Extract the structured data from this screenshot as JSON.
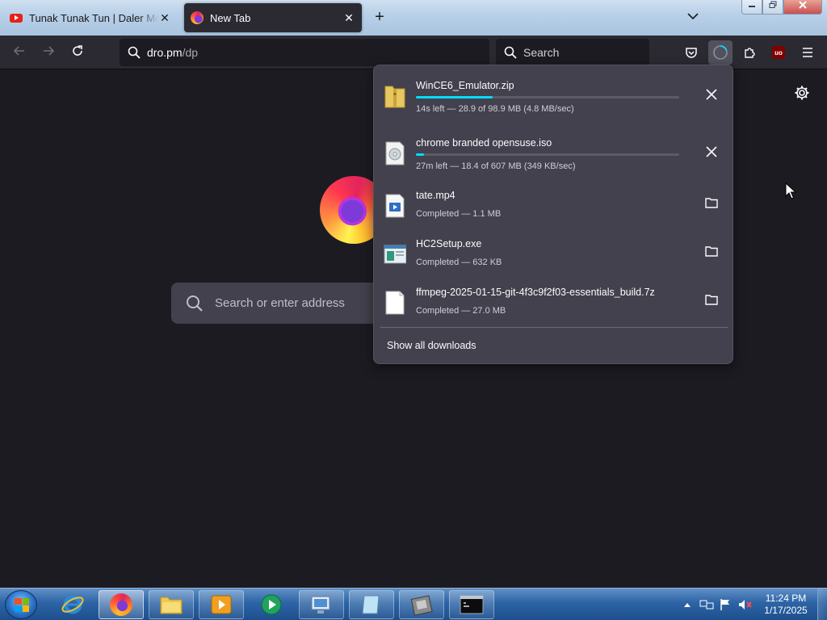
{
  "tabs": [
    {
      "title": "Tunak Tunak Tun | Daler Mehndi",
      "icon": "youtube-icon",
      "close": "✕"
    },
    {
      "title": "New Tab",
      "icon": "firefox-icon",
      "close": "✕"
    }
  ],
  "new_tab_label": "+",
  "urlbar": {
    "host": "dro.pm",
    "path": "/dp"
  },
  "searchbar": {
    "placeholder": "Search"
  },
  "newtab_search": {
    "placeholder": "Search or enter address"
  },
  "downloads": {
    "items": [
      {
        "name": "WinCE6_Emulator.zip",
        "status": "14s left — 28.9 of 98.9 MB (4.8 MB/sec)",
        "progress": 0.29,
        "action": "cancel",
        "icon": "zip-file-icon"
      },
      {
        "name": "chrome branded opensuse.iso",
        "status": "27m left — 18.4 of 607 MB (349 KB/sec)",
        "progress": 0.03,
        "action": "cancel",
        "icon": "disc-image-icon"
      },
      {
        "name": "tate.mp4",
        "status": "Completed — 1.1 MB",
        "action": "show-in-folder",
        "icon": "video-file-icon"
      },
      {
        "name": "HC2Setup.exe",
        "status": "Completed — 632 KB",
        "action": "show-in-folder",
        "icon": "exe-file-icon"
      },
      {
        "name": "ffmpeg-2025-01-15-git-4f3c9f2f03-essentials_build.7z",
        "status": "Completed — 27.0 MB",
        "action": "show-in-folder",
        "icon": "generic-file-icon"
      }
    ],
    "show_all": "Show all downloads"
  },
  "taskbar": {
    "apps": [
      "internet-explorer",
      "firefox",
      "file-explorer",
      "media-player",
      "media-center",
      "control-panel",
      "notepad-app",
      "utility-app",
      "command-prompt"
    ]
  },
  "clock": {
    "time": "11:24 PM",
    "date": "1/17/2025"
  },
  "colors": {
    "accent": "#00ddff",
    "panel": "#42414d",
    "chrome": "#2b2a33",
    "page": "#1c1b22"
  }
}
